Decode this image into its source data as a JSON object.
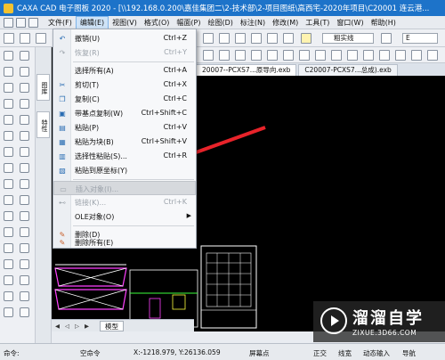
{
  "window": {
    "title": "CAXA CAD 电子图板 2020 - [\\\\192.168.0.200\\嘉佳集团二\\2-技术部\\2-项目图纸\\高西宅-2020年项目\\C20001 连云港..."
  },
  "menubar": {
    "items": [
      {
        "label": "文件(F)",
        "active": false
      },
      {
        "label": "编辑(E)",
        "active": true
      },
      {
        "label": "视图(V)",
        "active": false
      },
      {
        "label": "格式(O)",
        "active": false
      },
      {
        "label": "幅面(P)",
        "active": false
      },
      {
        "label": "绘图(D)",
        "active": false
      },
      {
        "label": "标注(N)",
        "active": false
      },
      {
        "label": "修改(M)",
        "active": false
      },
      {
        "label": "工具(T)",
        "active": false
      },
      {
        "label": "窗口(W)",
        "active": false
      },
      {
        "label": "帮助(H)",
        "active": false
      }
    ]
  },
  "toolbar": {
    "font_select": "粗实线",
    "e_select": "E"
  },
  "sidebar": {
    "tab1": "图库",
    "tab2": "特性"
  },
  "doc_tabs": [
    {
      "label": "20007--PCXS7...原导向.exb",
      "active": true
    },
    {
      "label": "C20007-PCXS7...总成).exb",
      "active": false
    }
  ],
  "edit_menu": {
    "items": [
      {
        "label": "撤销(U)",
        "shortcut": "Ctrl+Z",
        "disabled": false,
        "icon": "undo-icon",
        "highlighted": false,
        "submenu": false
      },
      {
        "label": "恢复(R)",
        "shortcut": "Ctrl+Y",
        "disabled": true,
        "icon": "redo-icon",
        "highlighted": false,
        "submenu": false
      },
      {
        "label": "选择所有(A)",
        "shortcut": "Ctrl+A",
        "disabled": false,
        "icon": "",
        "highlighted": false,
        "submenu": false
      },
      {
        "label": "剪切(T)",
        "shortcut": "Ctrl+X",
        "disabled": false,
        "icon": "scissors-icon",
        "highlighted": false,
        "submenu": false
      },
      {
        "label": "复制(C)",
        "shortcut": "Ctrl+C",
        "disabled": false,
        "icon": "copy-icon",
        "highlighted": false,
        "submenu": false
      },
      {
        "label": "带基点复制(W)",
        "shortcut": "Ctrl+Shift+C",
        "disabled": false,
        "icon": "copy-basepoint-icon",
        "highlighted": false,
        "submenu": false
      },
      {
        "label": "粘贴(P)",
        "shortcut": "Ctrl+V",
        "disabled": false,
        "icon": "paste-icon",
        "highlighted": false,
        "submenu": false
      },
      {
        "label": "粘贴为块(B)",
        "shortcut": "Ctrl+Shift+V",
        "disabled": false,
        "icon": "paste-block-icon",
        "highlighted": false,
        "submenu": false
      },
      {
        "label": "选择性粘贴(S)...",
        "shortcut": "Ctrl+R",
        "disabled": false,
        "icon": "paste-special-icon",
        "highlighted": false,
        "submenu": false
      },
      {
        "label": "粘贴到原坐标(Y)",
        "shortcut": "",
        "disabled": false,
        "icon": "paste-origin-icon",
        "highlighted": false,
        "submenu": false
      },
      {
        "label": "插入对象(I)...",
        "shortcut": "",
        "disabled": true,
        "icon": "insert-object-icon",
        "highlighted": true,
        "submenu": false
      },
      {
        "label": "链接(K)...",
        "shortcut": "Ctrl+K",
        "disabled": true,
        "icon": "link-icon",
        "highlighted": false,
        "submenu": false
      },
      {
        "label": "OLE对象(O)",
        "shortcut": "",
        "disabled": false,
        "icon": "",
        "highlighted": false,
        "submenu": true
      },
      {
        "label": "删除(D)",
        "shortcut": "",
        "disabled": false,
        "icon": "eraser-icon",
        "highlighted": false,
        "submenu": false
      },
      {
        "label": "删除所有(E)",
        "shortcut": "",
        "disabled": false,
        "icon": "delete-all-icon",
        "highlighted": false,
        "submenu": false
      }
    ]
  },
  "model_tab": "模型",
  "status": {
    "command_label": "命令:",
    "command_value": "空命令",
    "coordinates": "X:-1218.979, Y:26136.059",
    "mode": "屏幕点",
    "right1": "正交",
    "right2": "线宽",
    "right3": "动态输入",
    "right4": "导航"
  },
  "watermark": {
    "title": "溜溜自学",
    "url": "ZIXUE.3D66.COM"
  },
  "colors": {
    "titlebar": "#1d73c9",
    "arrow": "#e8232a",
    "canvas": "#000000",
    "drawing_white": "#ffffff",
    "drawing_magenta": "#ff40ff",
    "drawing_green": "#3cff3c",
    "drawing_yellow": "#ffff3c"
  }
}
